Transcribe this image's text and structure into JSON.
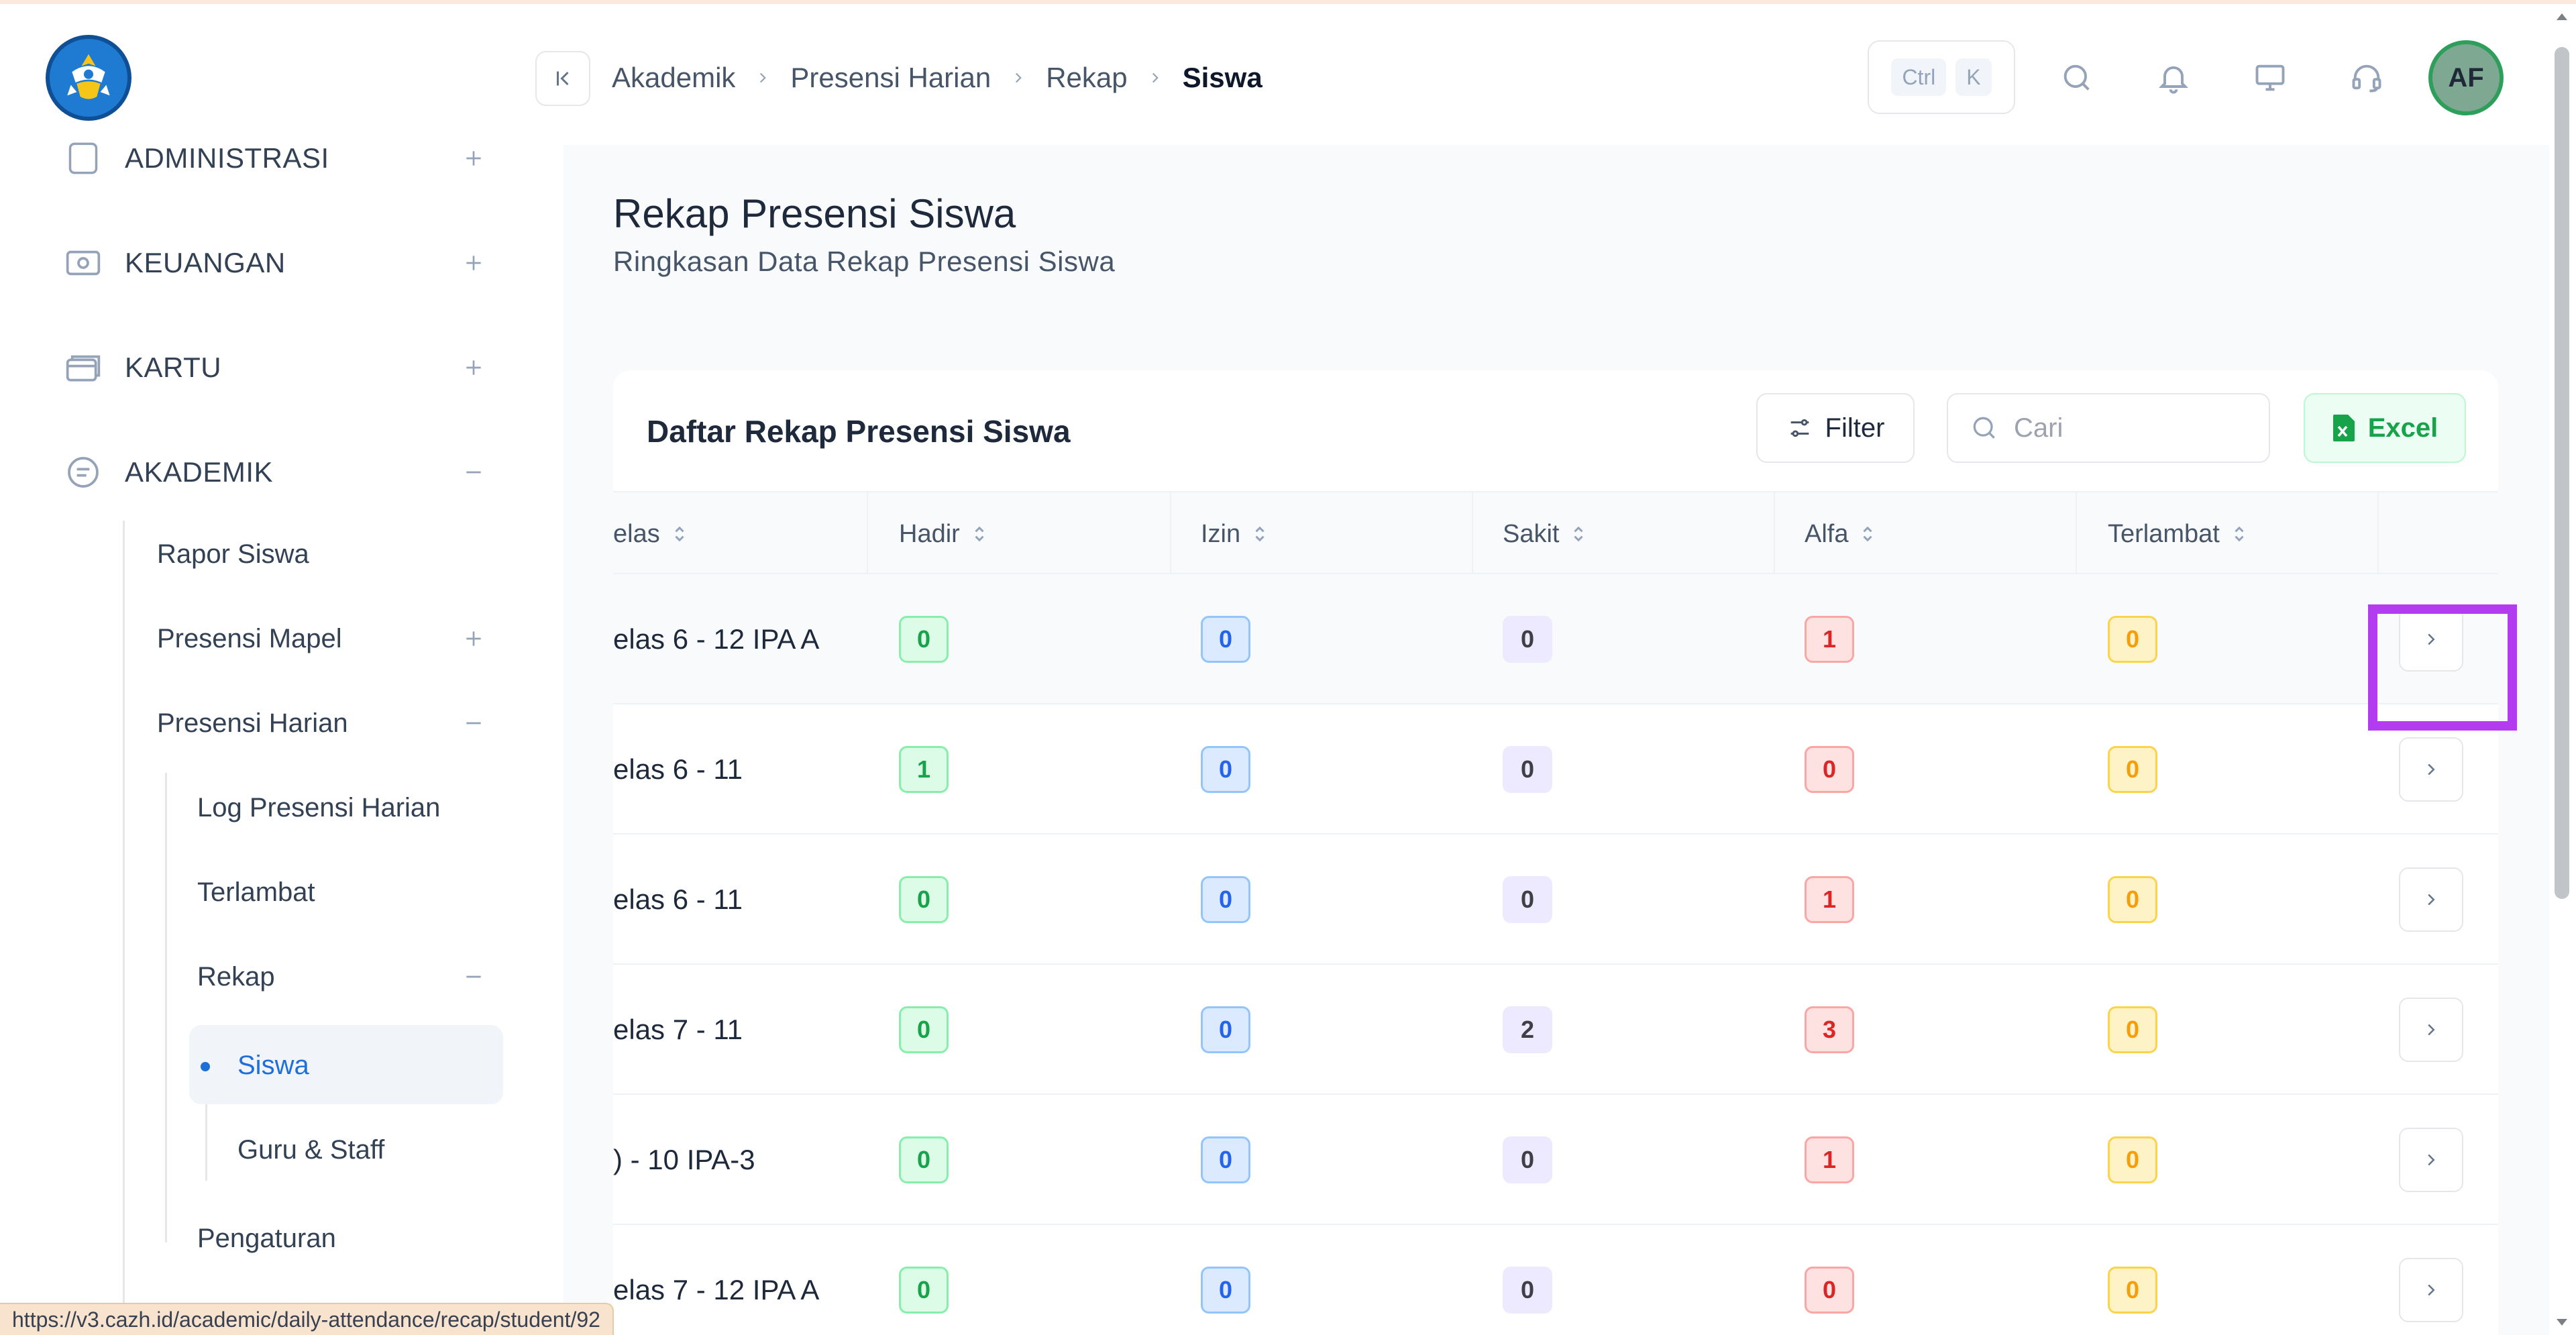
{
  "sidebar": {
    "logo_name": "tut-wuri-handayani-logo",
    "main_items": [
      {
        "label": "ADMINISTRASI",
        "toggle": "+"
      },
      {
        "label": "KEUANGAN",
        "toggle": "+"
      },
      {
        "label": "KARTU",
        "toggle": "+"
      },
      {
        "label": "AKADEMIK",
        "toggle": "−"
      }
    ],
    "akademik_items": {
      "rapor": "Rapor Siswa",
      "presensi_mapel": "Presensi Mapel",
      "presensi_harian": "Presensi Harian",
      "log": "Log Presensi Harian",
      "terlambat": "Terlambat",
      "rekap": "Rekap",
      "siswa": "Siswa",
      "guru_staff": "Guru & Staff",
      "pengaturan": "Pengaturan"
    }
  },
  "header": {
    "breadcrumb": [
      "Akademik",
      "Presensi Harian",
      "Rekap",
      "Siswa"
    ],
    "shortcut_keys": [
      "Ctrl",
      "K"
    ],
    "avatar_initials": "AF"
  },
  "page": {
    "title": "Rekap Presensi Siswa",
    "subtitle": "Ringkasan Data Rekap Presensi Siswa"
  },
  "card": {
    "title": "Daftar Rekap Presensi Siswa",
    "filter_label": "Filter",
    "search_placeholder": "Cari",
    "excel_label": "Excel"
  },
  "table": {
    "columns": [
      "elas",
      "Hadir",
      "Izin",
      "Sakit",
      "Alfa",
      "Terlambat"
    ],
    "rows": [
      {
        "kelas": "elas 6 - 12 IPA A",
        "hadir": "0",
        "izin": "0",
        "sakit": "0",
        "alfa": "1",
        "terlambat": "0"
      },
      {
        "kelas": "elas 6 - 11",
        "hadir": "1",
        "izin": "0",
        "sakit": "0",
        "alfa": "0",
        "terlambat": "0"
      },
      {
        "kelas": "elas 6 - 11",
        "hadir": "0",
        "izin": "0",
        "sakit": "0",
        "alfa": "1",
        "terlambat": "0"
      },
      {
        "kelas": "elas 7 - 11",
        "hadir": "0",
        "izin": "0",
        "sakit": "2",
        "alfa": "3",
        "terlambat": "0"
      },
      {
        "kelas": ") - 10 IPA-3",
        "hadir": "0",
        "izin": "0",
        "sakit": "0",
        "alfa": "1",
        "terlambat": "0"
      },
      {
        "kelas": "elas 7 - 12 IPA A",
        "hadir": "0",
        "izin": "0",
        "sakit": "0",
        "alfa": "0",
        "terlambat": "0"
      }
    ]
  },
  "status_bar": {
    "url": "https://v3.cazh.id/academic/daily-attendance/recap/student/92"
  },
  "colors": {
    "accent": "#1e6fd9",
    "highlight": "#b43cf0",
    "excel": "#16a34a"
  }
}
